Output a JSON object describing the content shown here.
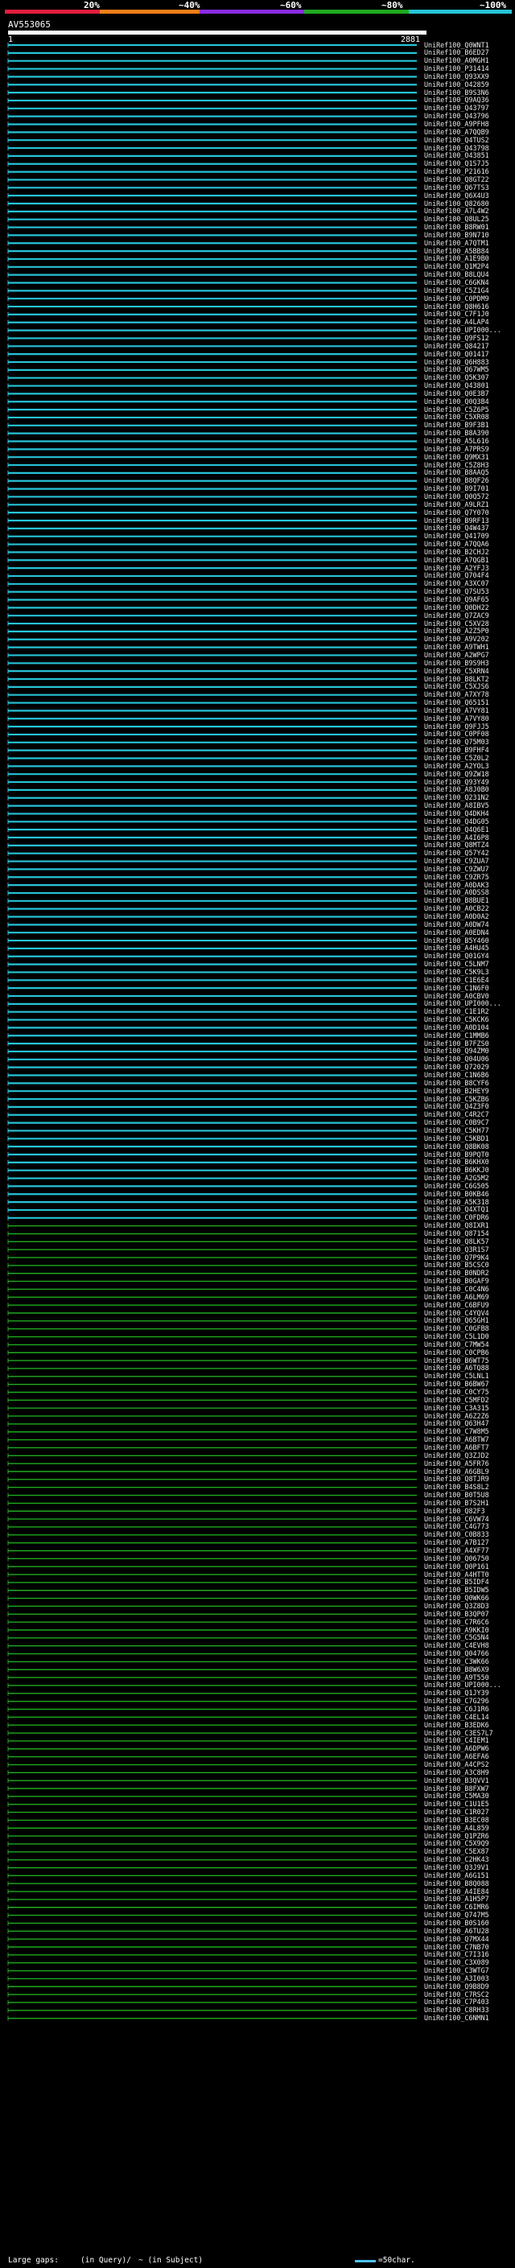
{
  "legend": {
    "labels": [
      "20%",
      "~40%",
      "~60%",
      "~80%",
      "~100%"
    ],
    "colors": [
      "#e01e3c",
      "#f07e1a",
      "#8a2be2",
      "#1faa1f",
      "#27c3d8"
    ]
  },
  "query": {
    "id": "AV553065",
    "start": "1",
    "end": "2881"
  },
  "footer": {
    "large_gaps": "Large gaps:",
    "in_query": "(in Query)/",
    "in_subject": "~ (in Subject)",
    "scale": "=50char."
  },
  "hits": [
    "UniRef100_Q0WNT1",
    "UniRef100_B6ED27",
    "UniRef100_A0MGH1",
    "UniRef100_P31414",
    "UniRef100_Q93XX9",
    "UniRef100_O42859",
    "UniRef100_B9S3N6",
    "UniRef100_Q9AQ36",
    "UniRef100_Q43797",
    "UniRef100_Q43796",
    "UniRef100_A9PFH8",
    "UniRef100_A7QQB9",
    "UniRef100_Q4TUS2",
    "UniRef100_Q43798",
    "UniRef100_O43851",
    "UniRef100_Q1S7J5",
    "UniRef100_P21616",
    "UniRef100_Q8GT22",
    "UniRef100_Q67TS3",
    "UniRef100_Q6X4U3",
    "UniRef100_Q82680",
    "UniRef100_A7L4W2",
    "UniRef100_Q8UL25",
    "UniRef100_B8RW01",
    "UniRef100_B9N710",
    "UniRef100_A7QTM1",
    "UniRef100_A5BB84",
    "UniRef100_A1E9B0",
    "UniRef100_Q1M2P4",
    "UniRef100_B8LQU4",
    "UniRef100_C6GKN4",
    "UniRef100_C5Z1G4",
    "UniRef100_C0PDM9",
    "UniRef100_Q8H616",
    "UniRef100_C7F1J0",
    "UniRef100_A4LAP4",
    "UniRef100_UPI000...",
    "UniRef100_Q9FS12",
    "UniRef100_Q84217",
    "UniRef100_Q01417",
    "UniRef100_Q6H883",
    "UniRef100_Q67WM5",
    "UniRef100_Q5K307",
    "UniRef100_Q43801",
    "UniRef100_Q0E3B7",
    "UniRef100_Q0Q3B4",
    "UniRef100_C5Z6P5",
    "UniRef100_C5XR08",
    "UniRef100_B9F3B1",
    "UniRef100_B8A390",
    "UniRef100_A5L616",
    "UniRef100_A7PRS9",
    "UniRef100_Q9MX31",
    "UniRef100_C5Z8H3",
    "UniRef100_B8AAQ5",
    "UniRef100_B8QF26",
    "UniRef100_B9I701",
    "UniRef100_Q0Q572",
    "UniRef100_A9LRZ1",
    "UniRef100_Q7Y070",
    "UniRef100_B9RF13",
    "UniRef100_Q4W437",
    "UniRef100_Q41709",
    "UniRef100_A7QQA6",
    "UniRef100_B2CHJ2",
    "UniRef100_A7QGB1",
    "UniRef100_A2YFJ3",
    "UniRef100_Q704F4",
    "UniRef100_A3XC07",
    "UniRef100_Q7SU53",
    "UniRef100_Q9AF65",
    "UniRef100_Q0DH22",
    "UniRef100_Q7ZAC9",
    "UniRef100_C5XV28",
    "UniRef100_A2Z5P0",
    "UniRef100_A9V202",
    "UniRef100_A9TWH1",
    "UniRef100_A2WPG7",
    "UniRef100_B9S9H3",
    "UniRef100_C5XRN4",
    "UniRef100_B8LKT2",
    "UniRef100_C5XJS6",
    "UniRef100_A7XY78",
    "UniRef100_Q65151",
    "UniRef100_A7VY81",
    "UniRef100_A7VY80",
    "UniRef100_Q9FJJ5",
    "UniRef100_C0PF08",
    "UniRef100_Q75M03",
    "UniRef100_B9FHF4",
    "UniRef100_C5Z0L2",
    "UniRef100_A2YOL3",
    "UniRef100_Q9ZW18",
    "UniRef100_Q93Y49",
    "UniRef100_A8J0B0",
    "UniRef100_Q231N2",
    "UniRef100_A8IBV5",
    "UniRef100_Q4DKH4",
    "UniRef100_Q4DG05",
    "UniRef100_Q4Q6E1",
    "UniRef100_A4I6P8",
    "UniRef100_Q8MTZ4",
    "UniRef100_Q57Y42",
    "UniRef100_C9ZUA7",
    "UniRef100_C9ZWU7",
    "UniRef100_C9ZR75",
    "UniRef100_A0DAK3",
    "UniRef100_A0DSS8",
    "UniRef100_B8BUE1",
    "UniRef100_A0CB22",
    "UniRef100_A0D0A2",
    "UniRef100_A0DW74",
    "UniRef100_A0EDN4",
    "UniRef100_B5Y460",
    "UniRef100_A4HU45",
    "UniRef100_Q01GY4",
    "UniRef100_C5LNM7",
    "UniRef100_C5K9L3",
    "UniRef100_C1E6E4",
    "UniRef100_C1N6F0",
    "UniRef100_A0CBV0",
    "UniRef100_UPI000...",
    "UniRef100_C1E1R2",
    "UniRef100_C5KCK6",
    "UniRef100_A0D104",
    "UniRef100_C1MMB6",
    "UniRef100_B7FZS0",
    "UniRef100_Q94ZM0",
    "UniRef100_Q04U06",
    "UniRef100_Q72029",
    "UniRef100_C1N6B6",
    "UniRef100_B8CYF6",
    "UniRef100_B2HEY9",
    "UniRef100_C5KZB6",
    "UniRef100_Q4Z3F0",
    "UniRef100_C4R2C7",
    "UniRef100_C0B9C7",
    "UniRef100_C5KH77",
    "UniRef100_C5KBD1",
    "UniRef100_Q8BK08",
    "UniRef100_B9PQT0",
    "UniRef100_B6KHX0",
    "UniRef100_B6KKJ0",
    "UniRef100_A2G5M2",
    "UniRef100_C6G505",
    "UniRef100_B0KB46",
    "UniRef100_A5K318",
    "UniRef100_Q4XTQ1",
    "UniRef100_C0FDR6",
    "UniRef100_Q8IXR1",
    "UniRef100_Q87154",
    "UniRef100_Q8LK57",
    "UniRef100_Q3R1S7",
    "UniRef100_Q7P9K4",
    "UniRef100_B5CSC0",
    "UniRef100_B0NDR2",
    "UniRef100_B0GAF9",
    "UniRef100_C0C4N6",
    "UniRef100_A6LM69",
    "UniRef100_C6BFU9",
    "UniRef100_C4YQV4",
    "UniRef100_Q65GH1",
    "UniRef100_C0GFB8",
    "UniRef100_C5L1D0",
    "UniRef100_C7MW54",
    "UniRef100_C0CPB6",
    "UniRef100_B6WT75",
    "UniRef100_A6TQ88",
    "UniRef100_C5LNL1",
    "UniRef100_B6BW67",
    "UniRef100_C0CY75",
    "UniRef100_C5MFD2",
    "UniRef100_C3A315",
    "UniRef100_A6Z2Z6",
    "UniRef100_Q63H47",
    "UniRef100_C7W8M5",
    "UniRef100_A6BTW7",
    "UniRef100_A6BFT7",
    "UniRef100_Q3ZJD2",
    "UniRef100_A5FR76",
    "UniRef100_A6GBL9",
    "UniRef100_Q8TJR9",
    "UniRef100_B4S8L2",
    "UniRef100_B0T5U8",
    "UniRef100_B7S2H1",
    "UniRef100_Q82F3",
    "UniRef100_C6VW74",
    "UniRef100_C4G773",
    "UniRef100_C0B833",
    "UniRef100_A7B127",
    "UniRef100_A4XF77",
    "UniRef100_Q06750",
    "UniRef100_Q0P161",
    "UniRef100_A4HTT0",
    "UniRef100_B5IDF4",
    "UniRef100_B5IDW5",
    "UniRef100_Q0WK66",
    "UniRef100_Q3Z8D3",
    "UniRef100_B3QP07",
    "UniRef100_C7R6C6",
    "UniRef100_A9KKI0",
    "UniRef100_C5G5N4",
    "UniRef100_C4EVH8",
    "UniRef100_Q04766",
    "UniRef100_C3WK66",
    "UniRef100_B8W6X9",
    "UniRef100_A9T550",
    "UniRef100_UPI000...",
    "UniRef100_Q1JY39",
    "UniRef100_C7G296",
    "UniRef100_C6J1R6",
    "UniRef100_C4EL14",
    "UniRef100_B3EDK6",
    "UniRef100_C3ES7L7",
    "UniRef100_C4IEM1",
    "UniRef100_A6DPW6",
    "UniRef100_A6EFA6",
    "UniRef100_A4CPS2",
    "UniRef100_A3C8H9",
    "UniRef100_B3QVV1",
    "UniRef100_B8FXW7",
    "UniRef100_C5MA30",
    "UniRef100_C1U1E5",
    "UniRef100_C1R027",
    "UniRef100_B3EC08",
    "UniRef100_A4L859",
    "UniRef100_Q1PZR6",
    "UniRef100_C5X9Q9",
    "UniRef100_C5EX87",
    "UniRef100_C2HK43",
    "UniRef100_Q3J9V1",
    "UniRef100_A6G151",
    "UniRef100_B8Q088",
    "UniRef100_A4IE84",
    "UniRef100_A1H5P7",
    "UniRef100_C6IMR6",
    "UniRef100_Q747M5",
    "UniRef100_B0S160",
    "UniRef100_A6TU28",
    "UniRef100_Q7MX44",
    "UniRef100_C7NB70",
    "UniRef100_C7I316",
    "UniRef100_C3X089",
    "UniRef100_C3WTG7",
    "UniRef100_A3I003",
    "UniRef100_Q9B8D9",
    "UniRef100_C7RSC2",
    "UniRef100_C7P403",
    "UniRef100_C8RH33",
    "UniRef100_C6NMN1"
  ]
}
